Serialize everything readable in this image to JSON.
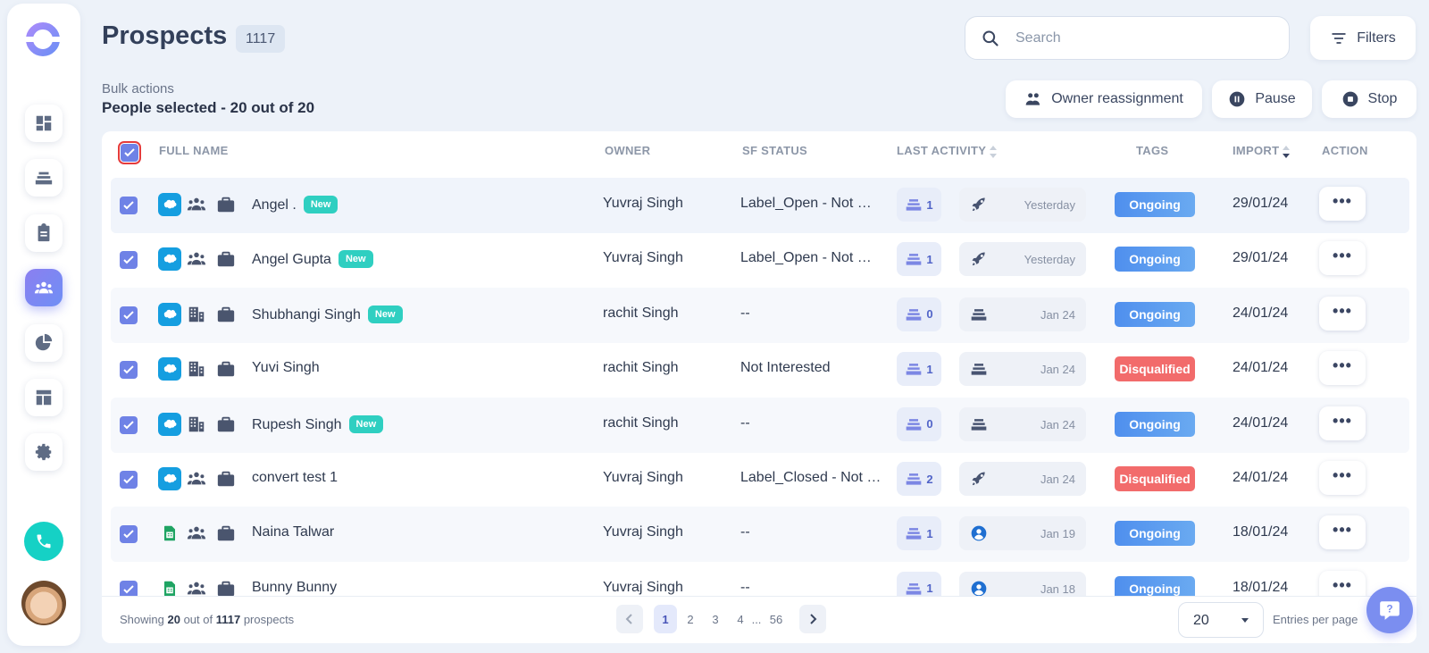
{
  "page": {
    "title": "Prospects",
    "count": "1117"
  },
  "search": {
    "placeholder": "Search"
  },
  "toolbar": {
    "filters_label": "Filters",
    "owner_label": "Owner reassignment",
    "pause_label": "Pause",
    "stop_label": "Stop"
  },
  "bulk": {
    "label": "Bulk actions",
    "selected": "People selected - 20 out of 20"
  },
  "sidebar": {
    "items": [
      {
        "icon": "dashboard-icon"
      },
      {
        "icon": "sequences-icon"
      },
      {
        "icon": "tasks-icon"
      },
      {
        "icon": "prospects-icon",
        "active": true
      },
      {
        "icon": "reports-icon"
      },
      {
        "icon": "templates-icon"
      },
      {
        "icon": "settings-icon"
      }
    ]
  },
  "columns": {
    "full_name": "FULL NAME",
    "owner": "OWNER",
    "sf_status": "SF STATUS",
    "last_activity": "LAST ACTIVITY",
    "tags": "TAGS",
    "import": "IMPORT",
    "action": "ACTION"
  },
  "new_label": "New",
  "rows": [
    {
      "name": "Angel .",
      "is_new": true,
      "source": "salesforce",
      "type": "team",
      "owner": "Yuvraj Singh",
      "sf_status": "Label_Open - Not Contacted",
      "activity_count": "1",
      "last_icon": "rocket-icon",
      "last_date": "Yesterday",
      "tag": "Ongoing",
      "import": "29/01/24"
    },
    {
      "name": "Angel Gupta",
      "is_new": true,
      "source": "salesforce",
      "type": "team",
      "owner": "Yuvraj Singh",
      "sf_status": "Label_Open - Not Contacted",
      "activity_count": "1",
      "last_icon": "rocket-icon",
      "last_date": "Yesterday",
      "tag": "Ongoing",
      "import": "29/01/24"
    },
    {
      "name": "Shubhangi Singh",
      "is_new": true,
      "source": "salesforce",
      "type": "building",
      "owner": "rachit Singh",
      "sf_status": "--",
      "activity_count": "0",
      "last_icon": "sequence-icon",
      "last_date": "Jan 24",
      "tag": "Ongoing",
      "import": "24/01/24"
    },
    {
      "name": "Yuvi Singh",
      "is_new": false,
      "source": "salesforce",
      "type": "building",
      "owner": "rachit Singh",
      "sf_status": "Not Interested",
      "activity_count": "1",
      "last_icon": "sequence-icon",
      "last_date": "Jan 24",
      "tag": "Disqualified",
      "import": "24/01/24"
    },
    {
      "name": "Rupesh Singh",
      "is_new": true,
      "source": "salesforce",
      "type": "building",
      "owner": "rachit Singh",
      "sf_status": "--",
      "activity_count": "0",
      "last_icon": "sequence-icon",
      "last_date": "Jan 24",
      "tag": "Ongoing",
      "import": "24/01/24"
    },
    {
      "name": "convert test 1",
      "is_new": false,
      "source": "salesforce",
      "type": "team",
      "owner": "Yuvraj Singh",
      "sf_status": "Label_Closed - Not Converted",
      "activity_count": "2",
      "last_icon": "rocket-icon",
      "last_date": "Jan 24",
      "tag": "Disqualified",
      "import": "24/01/24"
    },
    {
      "name": "Naina Talwar",
      "is_new": false,
      "source": "sheets",
      "type": "team",
      "owner": "Yuvraj Singh",
      "sf_status": "--",
      "activity_count": "1",
      "last_icon": "user-icon",
      "last_date": "Jan 19",
      "tag": "Ongoing",
      "import": "18/01/24"
    },
    {
      "name": "Bunny Bunny",
      "is_new": false,
      "source": "sheets",
      "type": "team",
      "owner": "Yuvraj Singh",
      "sf_status": "--",
      "activity_count": "1",
      "last_icon": "user-icon",
      "last_date": "Jan 18",
      "tag": "Ongoing",
      "import": "18/01/24"
    }
  ],
  "footer": {
    "showing_prefix": "Showing ",
    "shown": "20",
    "out_of": " out of ",
    "total": "1117",
    "suffix": " prospects",
    "pages": [
      "1",
      "2",
      "3",
      "4"
    ],
    "ellipsis": "...",
    "last_page": "56",
    "per_page": "20",
    "entries_label": "Entries per page"
  },
  "colors": {
    "accent": "#7b8ef0",
    "ongoing": "#4f8fee",
    "disqualified": "#f26b6b",
    "new": "#2fcfc1",
    "salesforce": "#159ee0"
  }
}
